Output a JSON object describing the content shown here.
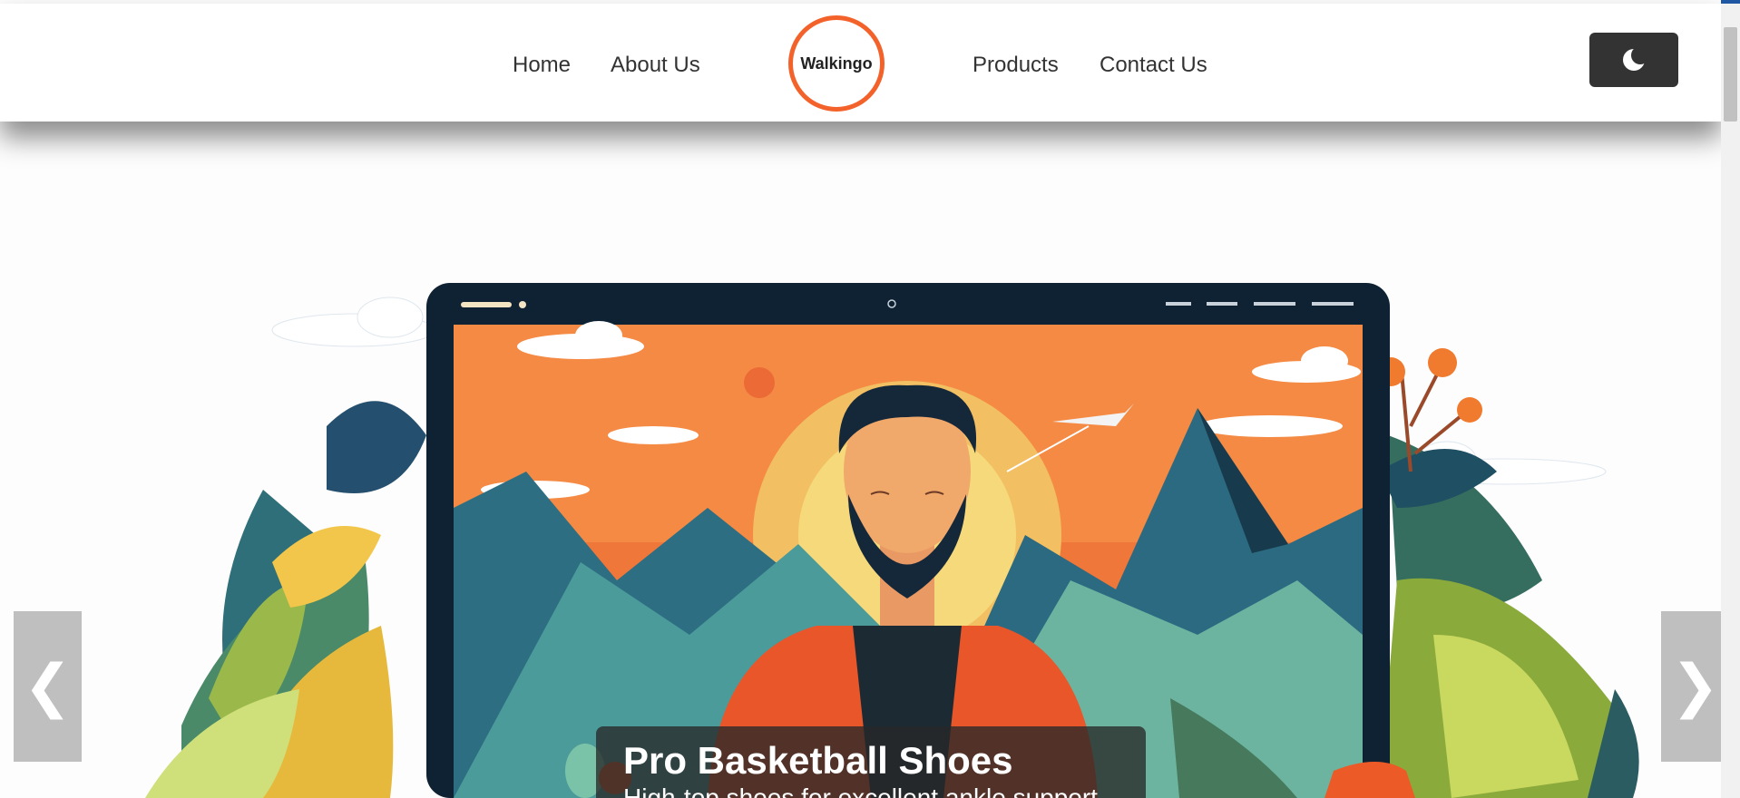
{
  "header": {
    "nav_left": [
      {
        "label": "Home"
      },
      {
        "label": "About Us"
      }
    ],
    "logo_text": "Walkingo",
    "nav_right": [
      {
        "label": "Products"
      },
      {
        "label": "Contact Us"
      }
    ],
    "theme_toggle_icon": "moon-icon"
  },
  "hero": {
    "slide_title": "Pro Basketball Shoes",
    "slide_subtitle": "High-top shoes for excellent ankle support.",
    "prev_arrow": "❮",
    "next_arrow": "❯"
  },
  "colors": {
    "accent": "#f4622b",
    "top_bar": "#1f57a3",
    "toggle_bg": "#333333"
  }
}
